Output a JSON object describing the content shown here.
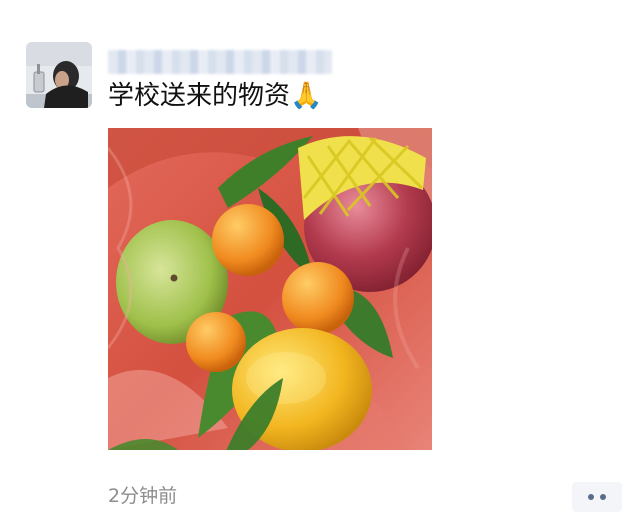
{
  "post": {
    "text": "学校送来的物资🙏",
    "timestamp": "2分钟前"
  },
  "icons": {
    "avatar": "user-avatar",
    "photo": "fruit-photo",
    "more": "more-dots-icon"
  },
  "colors": {
    "timestamp": "#8d8d8d",
    "more_button_bg": "#f3f5f8",
    "more_dots": "#5b6b8c"
  }
}
